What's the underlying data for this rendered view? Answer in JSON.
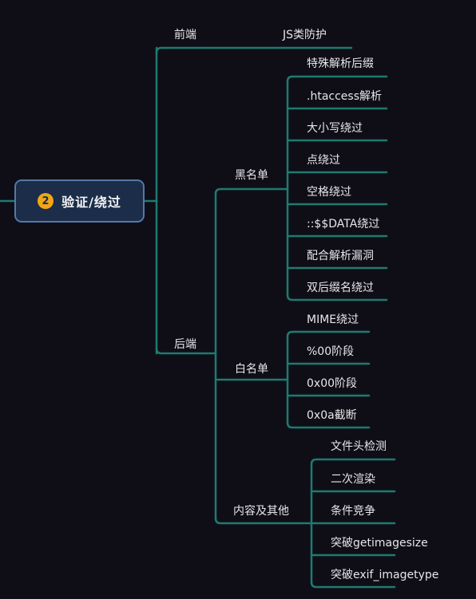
{
  "colors": {
    "background": "#0f0e17",
    "connector": "#1f7a70",
    "root_fill": "#1b2d48",
    "root_border": "#5677a8",
    "badge": "#f2a516",
    "text": "#e6e6ea"
  },
  "root": {
    "badge": "2",
    "title": "验证/绕过"
  },
  "branches": {
    "frontend": {
      "label": "前端",
      "items": [
        "JS类防护"
      ]
    },
    "backend": {
      "label": "后端",
      "blacklist": {
        "label": "黑名单",
        "items": [
          "特殊解析后缀",
          ".htaccess解析",
          "大小写绕过",
          "点绕过",
          "空格绕过",
          "::$$DATA绕过",
          "配合解析漏洞",
          "双后缀名绕过"
        ]
      },
      "whitelist": {
        "label": "白名单",
        "items": [
          "MIME绕过",
          "%00阶段",
          "0x00阶段",
          "0x0a截断"
        ]
      },
      "content": {
        "label": "内容及其他",
        "items": [
          "文件头检测",
          "二次渲染",
          "条件竞争",
          "突破getimagesize",
          "突破exif_imagetype"
        ]
      }
    }
  }
}
